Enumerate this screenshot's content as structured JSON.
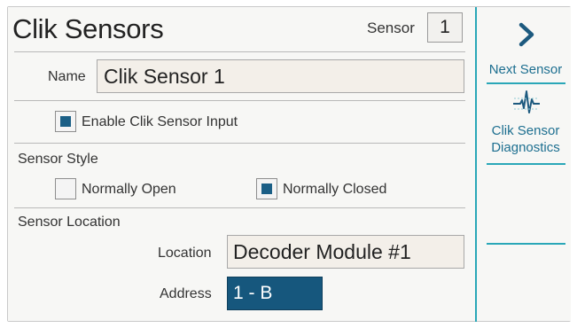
{
  "header": {
    "title": "Clik Sensors",
    "sensor_label": "Sensor",
    "sensor_value": "1"
  },
  "name_field": {
    "label": "Name",
    "value": "Clik Sensor 1"
  },
  "enable_input": {
    "label": "Enable Clik Sensor Input",
    "checked": true
  },
  "sensor_style": {
    "heading": "Sensor Style",
    "options": [
      {
        "label": "Normally Open",
        "checked": false
      },
      {
        "label": "Normally Closed",
        "checked": true
      }
    ]
  },
  "sensor_location": {
    "heading": "Sensor Location",
    "location_label": "Location",
    "location_value": "Decoder Module #1",
    "address_label": "Address",
    "address_value": "1 - B"
  },
  "sidebar": {
    "next_label": "Next Sensor",
    "diagnostics_line1": "Clik Sensor",
    "diagnostics_line2": "Diagnostics",
    "next_icon": "chevron-right-icon",
    "diagnostics_icon": "pulse-waveform-icon"
  },
  "colors": {
    "accent": "#2aa7b8",
    "selected": "#16577d",
    "link_text": "#1d6f90"
  }
}
